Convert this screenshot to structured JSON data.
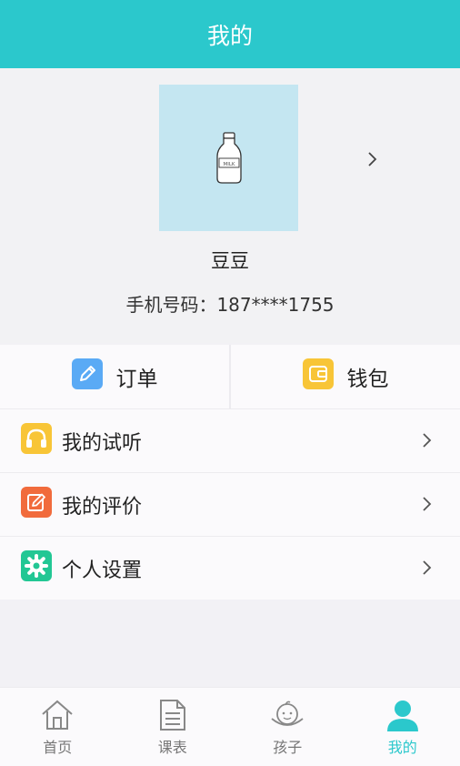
{
  "header": {
    "title": "我的"
  },
  "profile": {
    "avatar_text": "MILK",
    "nickname": "豆豆",
    "phone": "手机号码：187****1755"
  },
  "quick_actions": [
    {
      "label": "订单",
      "icon": "pencil-icon",
      "color": "#5aaaf5"
    },
    {
      "label": "钱包",
      "icon": "wallet-icon",
      "color": "#f8c537"
    }
  ],
  "menu": [
    {
      "label": "我的试听",
      "icon": "headphones-icon",
      "color": "#f8c537"
    },
    {
      "label": "我的评价",
      "icon": "edit-icon",
      "color": "#f16b3c"
    },
    {
      "label": "个人设置",
      "icon": "gear-icon",
      "color": "#22c794"
    }
  ],
  "tabbar": [
    {
      "label": "首页",
      "icon": "home-icon"
    },
    {
      "label": "课表",
      "icon": "document-icon"
    },
    {
      "label": "孩子",
      "icon": "child-icon"
    },
    {
      "label": "我的",
      "icon": "person-icon",
      "active": true
    }
  ],
  "colors": {
    "accent": "#2bc8cc",
    "avatar_bg": "#c4e6f1"
  }
}
